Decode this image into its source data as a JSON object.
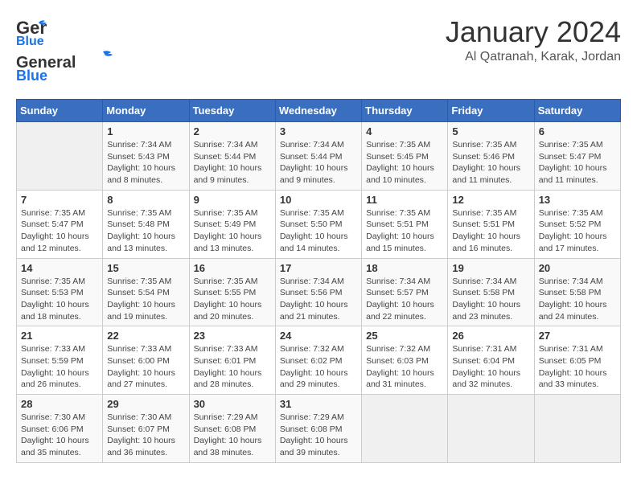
{
  "header": {
    "logo_line1": "General",
    "logo_line2": "Blue",
    "month": "January 2024",
    "location": "Al Qatranah, Karak, Jordan"
  },
  "weekdays": [
    "Sunday",
    "Monday",
    "Tuesday",
    "Wednesday",
    "Thursday",
    "Friday",
    "Saturday"
  ],
  "weeks": [
    [
      {
        "day": "",
        "info": ""
      },
      {
        "day": "1",
        "info": "Sunrise: 7:34 AM\nSunset: 5:43 PM\nDaylight: 10 hours\nand 8 minutes."
      },
      {
        "day": "2",
        "info": "Sunrise: 7:34 AM\nSunset: 5:44 PM\nDaylight: 10 hours\nand 9 minutes."
      },
      {
        "day": "3",
        "info": "Sunrise: 7:34 AM\nSunset: 5:44 PM\nDaylight: 10 hours\nand 9 minutes."
      },
      {
        "day": "4",
        "info": "Sunrise: 7:35 AM\nSunset: 5:45 PM\nDaylight: 10 hours\nand 10 minutes."
      },
      {
        "day": "5",
        "info": "Sunrise: 7:35 AM\nSunset: 5:46 PM\nDaylight: 10 hours\nand 11 minutes."
      },
      {
        "day": "6",
        "info": "Sunrise: 7:35 AM\nSunset: 5:47 PM\nDaylight: 10 hours\nand 11 minutes."
      }
    ],
    [
      {
        "day": "7",
        "info": "Sunrise: 7:35 AM\nSunset: 5:47 PM\nDaylight: 10 hours\nand 12 minutes."
      },
      {
        "day": "8",
        "info": "Sunrise: 7:35 AM\nSunset: 5:48 PM\nDaylight: 10 hours\nand 13 minutes."
      },
      {
        "day": "9",
        "info": "Sunrise: 7:35 AM\nSunset: 5:49 PM\nDaylight: 10 hours\nand 13 minutes."
      },
      {
        "day": "10",
        "info": "Sunrise: 7:35 AM\nSunset: 5:50 PM\nDaylight: 10 hours\nand 14 minutes."
      },
      {
        "day": "11",
        "info": "Sunrise: 7:35 AM\nSunset: 5:51 PM\nDaylight: 10 hours\nand 15 minutes."
      },
      {
        "day": "12",
        "info": "Sunrise: 7:35 AM\nSunset: 5:51 PM\nDaylight: 10 hours\nand 16 minutes."
      },
      {
        "day": "13",
        "info": "Sunrise: 7:35 AM\nSunset: 5:52 PM\nDaylight: 10 hours\nand 17 minutes."
      }
    ],
    [
      {
        "day": "14",
        "info": "Sunrise: 7:35 AM\nSunset: 5:53 PM\nDaylight: 10 hours\nand 18 minutes."
      },
      {
        "day": "15",
        "info": "Sunrise: 7:35 AM\nSunset: 5:54 PM\nDaylight: 10 hours\nand 19 minutes."
      },
      {
        "day": "16",
        "info": "Sunrise: 7:35 AM\nSunset: 5:55 PM\nDaylight: 10 hours\nand 20 minutes."
      },
      {
        "day": "17",
        "info": "Sunrise: 7:34 AM\nSunset: 5:56 PM\nDaylight: 10 hours\nand 21 minutes."
      },
      {
        "day": "18",
        "info": "Sunrise: 7:34 AM\nSunset: 5:57 PM\nDaylight: 10 hours\nand 22 minutes."
      },
      {
        "day": "19",
        "info": "Sunrise: 7:34 AM\nSunset: 5:58 PM\nDaylight: 10 hours\nand 23 minutes."
      },
      {
        "day": "20",
        "info": "Sunrise: 7:34 AM\nSunset: 5:58 PM\nDaylight: 10 hours\nand 24 minutes."
      }
    ],
    [
      {
        "day": "21",
        "info": "Sunrise: 7:33 AM\nSunset: 5:59 PM\nDaylight: 10 hours\nand 26 minutes."
      },
      {
        "day": "22",
        "info": "Sunrise: 7:33 AM\nSunset: 6:00 PM\nDaylight: 10 hours\nand 27 minutes."
      },
      {
        "day": "23",
        "info": "Sunrise: 7:33 AM\nSunset: 6:01 PM\nDaylight: 10 hours\nand 28 minutes."
      },
      {
        "day": "24",
        "info": "Sunrise: 7:32 AM\nSunset: 6:02 PM\nDaylight: 10 hours\nand 29 minutes."
      },
      {
        "day": "25",
        "info": "Sunrise: 7:32 AM\nSunset: 6:03 PM\nDaylight: 10 hours\nand 31 minutes."
      },
      {
        "day": "26",
        "info": "Sunrise: 7:31 AM\nSunset: 6:04 PM\nDaylight: 10 hours\nand 32 minutes."
      },
      {
        "day": "27",
        "info": "Sunrise: 7:31 AM\nSunset: 6:05 PM\nDaylight: 10 hours\nand 33 minutes."
      }
    ],
    [
      {
        "day": "28",
        "info": "Sunrise: 7:30 AM\nSunset: 6:06 PM\nDaylight: 10 hours\nand 35 minutes."
      },
      {
        "day": "29",
        "info": "Sunrise: 7:30 AM\nSunset: 6:07 PM\nDaylight: 10 hours\nand 36 minutes."
      },
      {
        "day": "30",
        "info": "Sunrise: 7:29 AM\nSunset: 6:08 PM\nDaylight: 10 hours\nand 38 minutes."
      },
      {
        "day": "31",
        "info": "Sunrise: 7:29 AM\nSunset: 6:08 PM\nDaylight: 10 hours\nand 39 minutes."
      },
      {
        "day": "",
        "info": ""
      },
      {
        "day": "",
        "info": ""
      },
      {
        "day": "",
        "info": ""
      }
    ]
  ]
}
